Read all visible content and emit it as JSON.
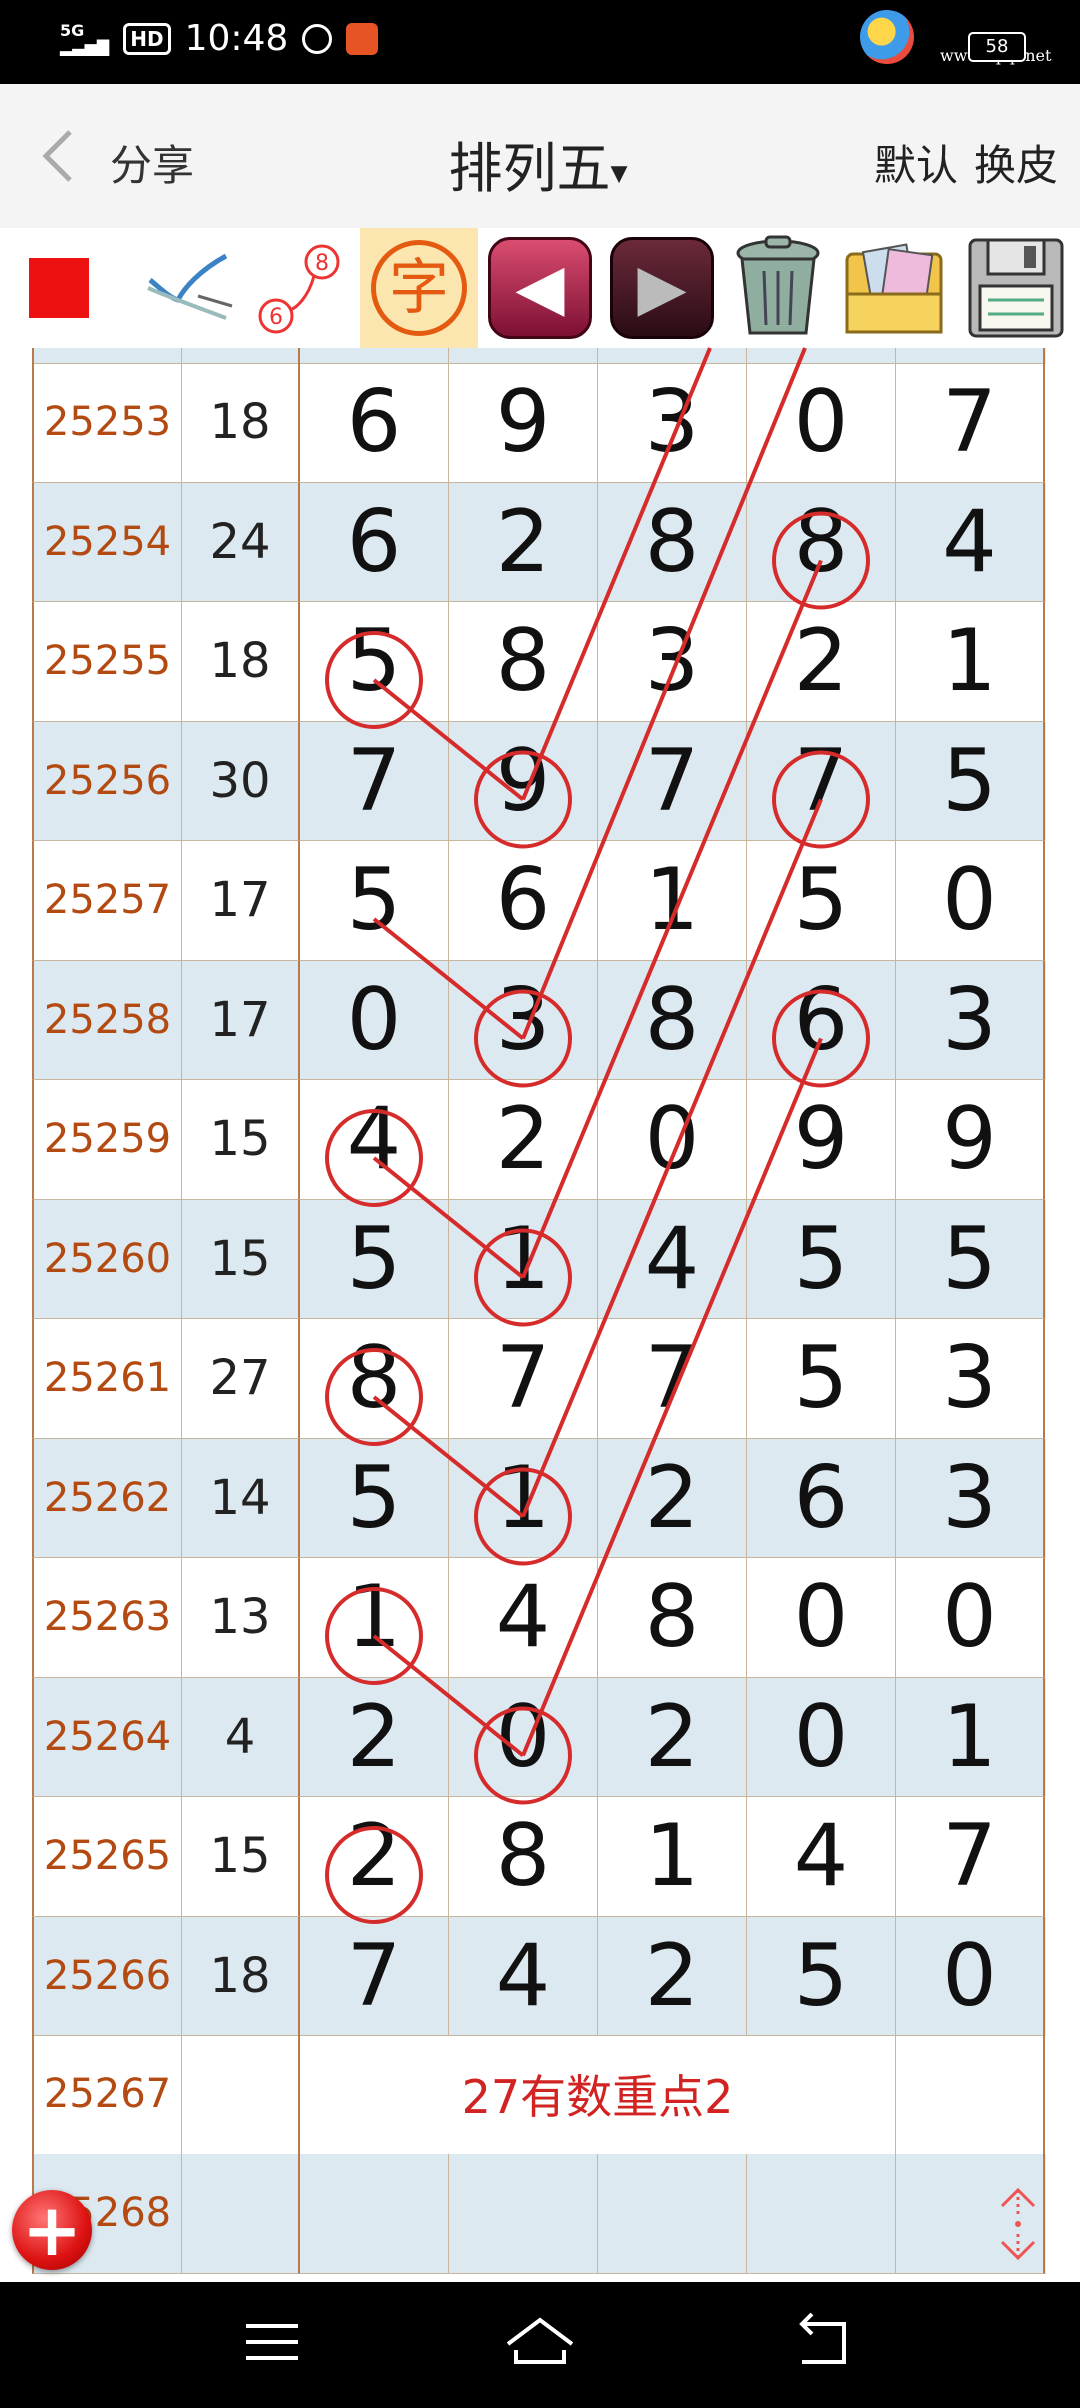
{
  "status": {
    "network": "5G",
    "hd": "HD",
    "time": "10:48",
    "battery": "58",
    "watermark_site": "",
    "watermark_url": "www.tqcp.net"
  },
  "header": {
    "share_label": "分享",
    "title": "排列五",
    "caret": "▾",
    "default_label": "默认",
    "skin_label": "换皮"
  },
  "toolbar": {
    "char_label": "字",
    "badge_top": "8",
    "badge_bottom": "6"
  },
  "table": {
    "rows": [
      {
        "issue": "25253",
        "sum": "18",
        "digits": [
          "6",
          "9",
          "3",
          "0",
          "7"
        ]
      },
      {
        "issue": "25254",
        "sum": "24",
        "digits": [
          "6",
          "2",
          "8",
          "8",
          "4"
        ]
      },
      {
        "issue": "25255",
        "sum": "18",
        "digits": [
          "5",
          "8",
          "3",
          "2",
          "1"
        ]
      },
      {
        "issue": "25256",
        "sum": "30",
        "digits": [
          "7",
          "9",
          "7",
          "7",
          "5"
        ]
      },
      {
        "issue": "25257",
        "sum": "17",
        "digits": [
          "5",
          "6",
          "1",
          "5",
          "0"
        ]
      },
      {
        "issue": "25258",
        "sum": "17",
        "digits": [
          "0",
          "3",
          "8",
          "6",
          "3"
        ]
      },
      {
        "issue": "25259",
        "sum": "15",
        "digits": [
          "4",
          "2",
          "0",
          "9",
          "9"
        ]
      },
      {
        "issue": "25260",
        "sum": "15",
        "digits": [
          "5",
          "1",
          "4",
          "5",
          "5"
        ]
      },
      {
        "issue": "25261",
        "sum": "27",
        "digits": [
          "8",
          "7",
          "7",
          "5",
          "3"
        ]
      },
      {
        "issue": "25262",
        "sum": "14",
        "digits": [
          "5",
          "1",
          "2",
          "6",
          "3"
        ]
      },
      {
        "issue": "25263",
        "sum": "13",
        "digits": [
          "1",
          "4",
          "8",
          "0",
          "0"
        ]
      },
      {
        "issue": "25264",
        "sum": "4",
        "digits": [
          "2",
          "0",
          "2",
          "0",
          "1"
        ]
      },
      {
        "issue": "25265",
        "sum": "15",
        "digits": [
          "2",
          "8",
          "1",
          "4",
          "7"
        ]
      },
      {
        "issue": "25266",
        "sum": "18",
        "digits": [
          "7",
          "4",
          "2",
          "5",
          "0"
        ]
      }
    ],
    "note_row": {
      "issue": "25267",
      "note": "27有数重点2"
    },
    "last_row": {
      "issue": "25268"
    }
  },
  "colors": {
    "circle": "#d62b2b",
    "issue_text": "#b24a12",
    "row_alt": "#dde9f1"
  }
}
